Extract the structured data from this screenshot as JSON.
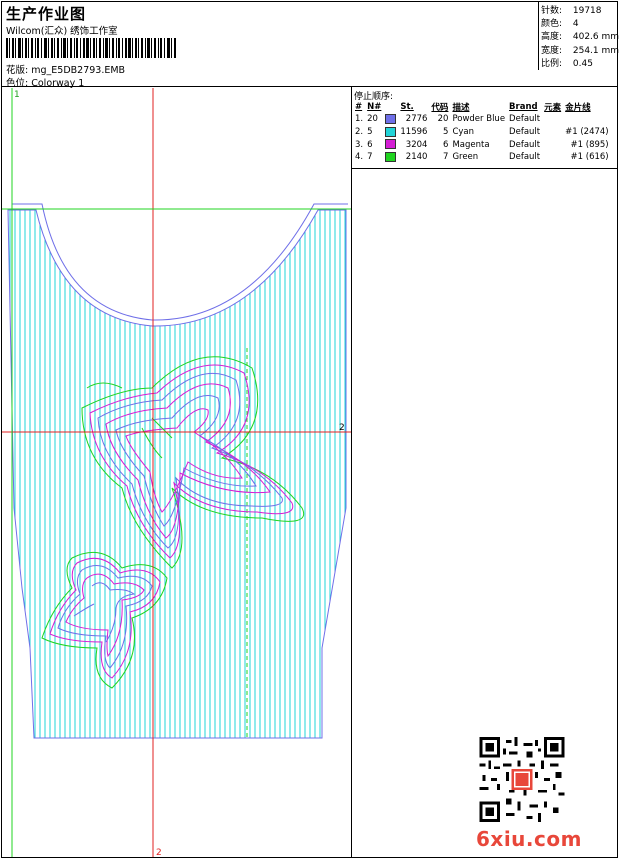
{
  "header": {
    "title": "生产作业图",
    "company": "Wilcom(汇众) 绣饰工作室",
    "design_file_label": "花版:",
    "design_file": "mg_E5DB2793.EMB",
    "colorway_label": "色位:",
    "colorway": "Colorway 1"
  },
  "stats": [
    {
      "label": "针数:",
      "value": "19718"
    },
    {
      "label": "颜色:",
      "value": "4"
    },
    {
      "label": "高度:",
      "value": "402.6 mm"
    },
    {
      "label": "宽度:",
      "value": "254.1 mm"
    },
    {
      "label": "比例:",
      "value": "0.45"
    }
  ],
  "sequence": {
    "title": "停止顺序:",
    "headers": {
      "num": "#",
      "n": "N#",
      "st": "St.",
      "code": "代码",
      "desc": "描述",
      "brand": "Brand",
      "element": "元素",
      "spool": "金片线"
    },
    "rows": [
      {
        "num": "1.",
        "n": "20",
        "color": "#6f6fe8",
        "st": "2776",
        "code": "20",
        "desc": "Powder Blue",
        "brand": "Default",
        "element": "",
        "spool": ""
      },
      {
        "num": "2.",
        "n": "5",
        "color": "#22d4d8",
        "st": "11596",
        "code": "5",
        "desc": "Cyan",
        "brand": "Default",
        "element": "",
        "spool": "#1 (2474)"
      },
      {
        "num": "3.",
        "n": "6",
        "color": "#d41ed4",
        "st": "3204",
        "code": "6",
        "desc": "Magenta",
        "brand": "Default",
        "element": "",
        "spool": "#1 (895)"
      },
      {
        "num": "4.",
        "n": "7",
        "color": "#20d420",
        "st": "2140",
        "code": "7",
        "desc": "Green",
        "brand": "Default",
        "element": "",
        "spool": "#1 (616)"
      }
    ]
  },
  "design": {
    "marker_1": "1",
    "marker_2_right": "2",
    "marker_2_bottom": "2"
  },
  "watermark": {
    "site": "6xiu.com"
  }
}
